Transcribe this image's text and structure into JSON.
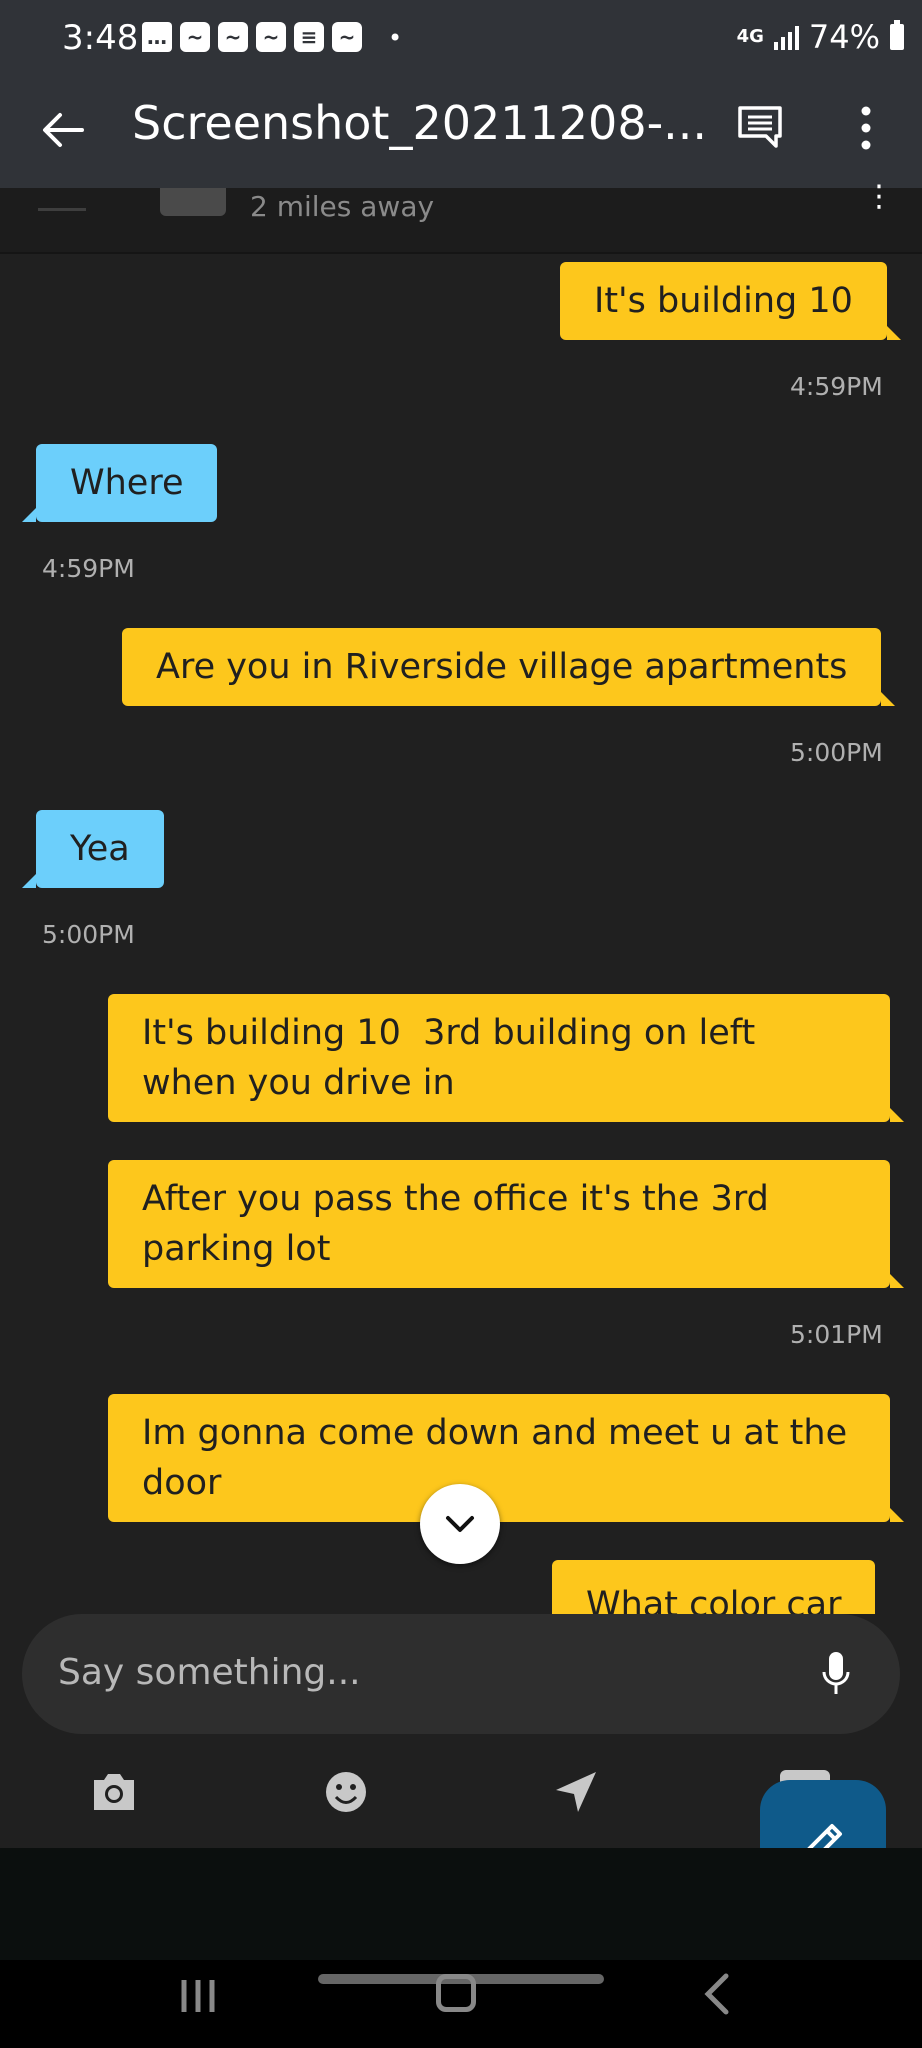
{
  "status_bar": {
    "time": "3:48",
    "notification_icons": [
      "message-icon",
      "chat-app-icon",
      "chat-app-icon",
      "chat-app-icon",
      "news-icon",
      "chat-app-icon"
    ],
    "network": "4G",
    "battery": "74%"
  },
  "viewer": {
    "title": "Screenshot_20211208-..."
  },
  "chat_header": {
    "distance": "2 miles away"
  },
  "messages": [
    {
      "side": "out",
      "text": "It's building 10",
      "time": "4:59PM"
    },
    {
      "side": "in",
      "text": "Where",
      "time": "4:59PM"
    },
    {
      "side": "out",
      "text": "Are you in Riverside village apartments",
      "time": "5:00PM"
    },
    {
      "side": "in",
      "text": "Yea",
      "time": "5:00PM"
    },
    {
      "side": "out",
      "lines": [
        "It's building 10  3rd building on left",
        "when you drive in"
      ]
    },
    {
      "side": "out",
      "lines": [
        "After you pass the office it's the 3rd",
        "parking lot"
      ],
      "time": "5:01PM"
    },
    {
      "side": "out",
      "lines": [
        "Im gonna come down and meet u at the",
        "door"
      ]
    },
    {
      "side": "out",
      "text": "What color car"
    }
  ],
  "composer": {
    "placeholder": "Say something..."
  },
  "actions": [
    "camera-icon",
    "emoji-icon",
    "location-icon",
    "gallery-icon"
  ]
}
